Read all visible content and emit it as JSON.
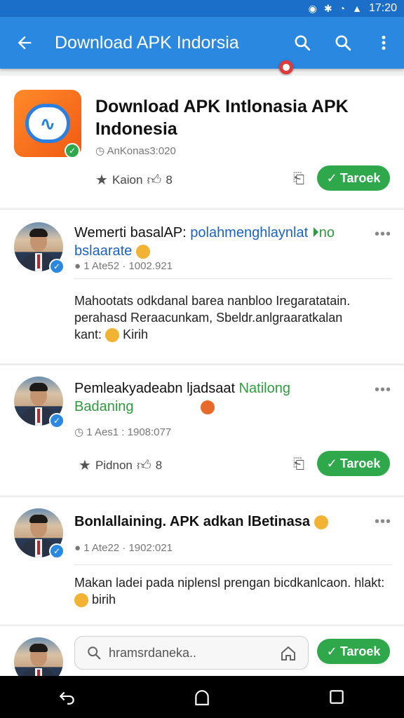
{
  "status": {
    "time": "17:20"
  },
  "appbar": {
    "title": "Download APK Indorsia"
  },
  "app": {
    "title": "Download APK Intlonasia APK Indonesia",
    "meta": "AnKonas3:020",
    "rating_label": "Kaion",
    "likes": "8",
    "install_label": "Taroek"
  },
  "posts": [
    {
      "title_dark": "Wemerti basalAP:",
      "title_blue": "polahmenghlaynlat",
      "title_green": "no",
      "title_line2": "bslaarate",
      "meta": "1 Ate52 · 1002.921",
      "body": "Mahootats odkdanal barea nanbloo Iregaratatain. perahasd Reraacunkam, Sbeldr.anlgraaratkalan",
      "body_tail": "kant:",
      "body_end": "Kirih"
    },
    {
      "title_dark": "Pemleakyadeabn ljadsaat",
      "title_green": "Natilong",
      "title_line2": "Badaning",
      "meta": "1 Aes1 : 1908:077",
      "rating_label": "Pidnon",
      "likes": "8",
      "install_label": "Taroek"
    },
    {
      "title": "Bonlallaining. APK adkan lBetinasa",
      "meta": "1 Ate22 · 1902:021",
      "body": "Makan ladei pada niplensl prengan bicdkanlcaon. hlakt:",
      "body_end": "birih"
    }
  ],
  "search": {
    "placeholder": "hramsrdaneka..",
    "install_label": "Taroek"
  },
  "colors": {
    "appbar": "#2a88e0",
    "statusbar": "#1c6fc9",
    "accent_green": "#2ea84a",
    "link_blue": "#1b62c7"
  }
}
